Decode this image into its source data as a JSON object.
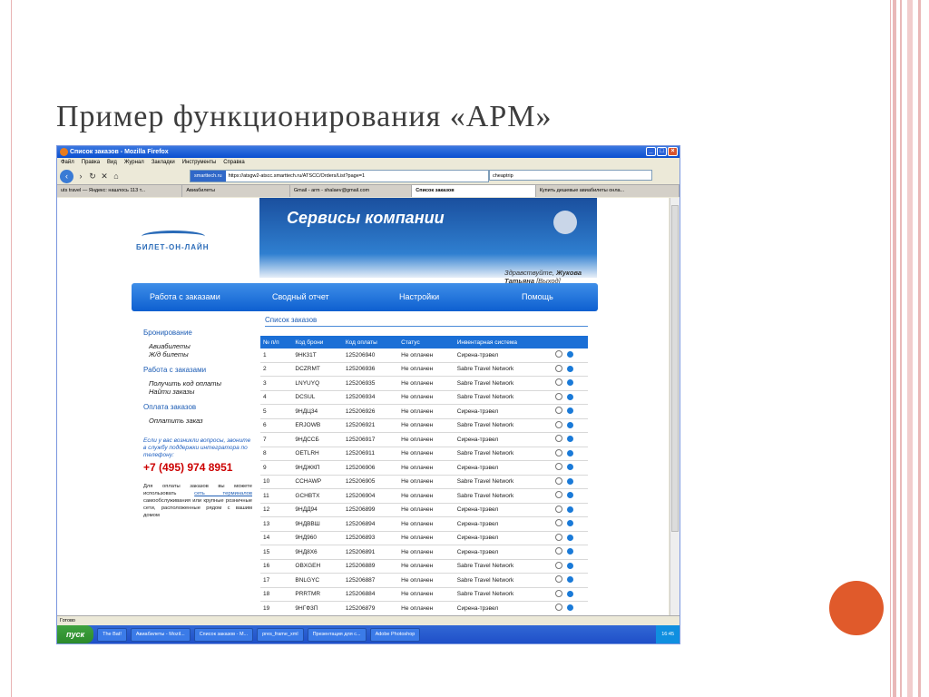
{
  "slide_title": "Пример функционирования «АРМ»",
  "window": {
    "title": "Список заказов - Mozilla Firefox",
    "menu": [
      "Файл",
      "Правка",
      "Вид",
      "Журнал",
      "Закладки",
      "Инструменты",
      "Справка"
    ],
    "url_site": "smarttech.ru",
    "url": "https://atsgw2-atscc.smarttech.ru/ATSCC/Orders/List?page=1",
    "search": "cheaptrip",
    "tabs": [
      "uts travel — Яндекс: нашлось 113 т...",
      "Авиабилеты",
      "Gmail - arm - shalaev@gmail.com",
      "Список заказов",
      "Купить дешевые авиабилеты онла..."
    ],
    "status": "Готово"
  },
  "site": {
    "logo": "БИЛЕТ-ОН-ЛАЙН",
    "banner_title": "Сервисы компании",
    "greeting_prefix": "Здравствуйте,",
    "user": "Жукова Татьяна",
    "logout": "[Выход]",
    "nav": [
      "Работа с заказами",
      "Сводный отчет",
      "Настройки",
      "Помощь"
    ]
  },
  "sidebar": {
    "booking": "Бронирование",
    "air": "Авиабилеты",
    "rail": "Ж/д билеты",
    "orders": "Работа с заказами",
    "get_code": "Получить код оплаты",
    "find": "Найти заказы",
    "payment": "Оплата заказов",
    "pay": "Оплатить заказ",
    "note": "Если у вас возникли вопросы, звоните в службу поддержки интегратора по телефону:",
    "phone": "+7 (495) 974 8951",
    "small_before": "Для оплаты заказов вы можете использовать",
    "small_link": "сеть терминалов",
    "small_after": "самообслуживания или крупные розничные сети, расположенные рядом с вашим домом"
  },
  "orders": {
    "title": "Список заказов",
    "columns": [
      "№ п/п",
      "Код брони",
      "Код оплаты",
      "Статус",
      "Инвентарная система"
    ],
    "rows": [
      [
        "1",
        "9НК31Т",
        "125206940",
        "Не оплачен",
        "Сирена-трэвел"
      ],
      [
        "2",
        "DCZRMT",
        "125206936",
        "Не оплачен",
        "Sabre Travel Network"
      ],
      [
        "3",
        "LNYUYQ",
        "125206935",
        "Не оплачен",
        "Sabre Travel Network"
      ],
      [
        "4",
        "DCSUL",
        "125206934",
        "Не оплачен",
        "Sabre Travel Network"
      ],
      [
        "5",
        "9НДЦ34",
        "125206926",
        "Не оплачен",
        "Сирена-трэвел"
      ],
      [
        "6",
        "ERJOWB",
        "125206921",
        "Не оплачен",
        "Sabre Travel Network"
      ],
      [
        "7",
        "9НДССБ",
        "125206917",
        "Не оплачен",
        "Сирена-трэвел"
      ],
      [
        "8",
        "OETLRH",
        "125206911",
        "Не оплачен",
        "Sabre Travel Network"
      ],
      [
        "9",
        "9НДЖКП",
        "125206906",
        "Не оплачен",
        "Сирена-трэвел"
      ],
      [
        "10",
        "CCHAWP",
        "125206905",
        "Не оплачен",
        "Sabre Travel Network"
      ],
      [
        "11",
        "GCHBTX",
        "125206904",
        "Не оплачен",
        "Sabre Travel Network"
      ],
      [
        "12",
        "9НДД94",
        "125206899",
        "Не оплачен",
        "Сирена-трэвел"
      ],
      [
        "13",
        "9НДВВШ",
        "125206894",
        "Не оплачен",
        "Сирена-трэвел"
      ],
      [
        "14",
        "9НД960",
        "125206893",
        "Не оплачен",
        "Сирена-трэвел"
      ],
      [
        "15",
        "9НД8Х6",
        "125206891",
        "Не оплачен",
        "Сирена-трэвел"
      ],
      [
        "16",
        "OBXGEH",
        "125206889",
        "Не оплачен",
        "Sabre Travel Network"
      ],
      [
        "17",
        "BNLGYC",
        "125206887",
        "Не оплачен",
        "Sabre Travel Network"
      ],
      [
        "18",
        "PRRTMR",
        "125206884",
        "Не оплачен",
        "Sabre Travel Network"
      ],
      [
        "19",
        "9НГФ3П",
        "125206879",
        "Не оплачен",
        "Сирена-трэвел"
      ]
    ]
  },
  "taskbar": {
    "start": "пуск",
    "items": [
      "The Bat!",
      "Авиабилеты - Mozil...",
      "Список заказов - M...",
      "pres_frame_xml",
      "Презентация для с...",
      "Adobe Photoshop"
    ],
    "clock": "16:45"
  },
  "colors": {
    "accent": "#1b6fd6",
    "phone": "#cc0000",
    "dot": "#e05a2b"
  }
}
